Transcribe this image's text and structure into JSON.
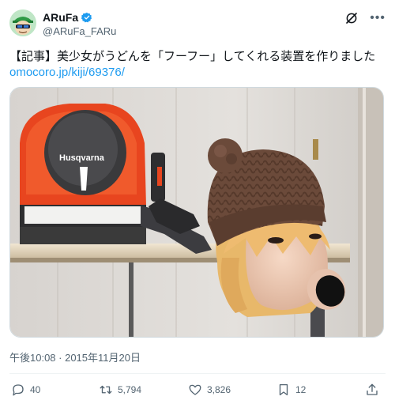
{
  "author": {
    "display_name": "ARuFa",
    "handle": "@ARuFa_FARu",
    "verified": true
  },
  "icons": {
    "verified": "verified-badge-icon",
    "grok": "grok-icon",
    "more": "more-icon",
    "reply": "reply-icon",
    "retweet": "retweet-icon",
    "like": "like-icon",
    "bookmark": "bookmark-icon",
    "share": "share-icon"
  },
  "tweet": {
    "text": "【記事】美少女がうどんを「フーフー」してくれる装置を作りました",
    "link": "omocoro.jp/kiji/69376/",
    "timestamp": "午後10:08 · 2015年11月20日"
  },
  "media": {
    "brand_label": "Husqvarna"
  },
  "stats": {
    "replies": "40",
    "retweets": "5,794",
    "likes": "3,826",
    "bookmarks": "12"
  },
  "colors": {
    "link": "#1d9bf0",
    "verified": "#1d9bf0",
    "secondary_text": "#536471"
  }
}
